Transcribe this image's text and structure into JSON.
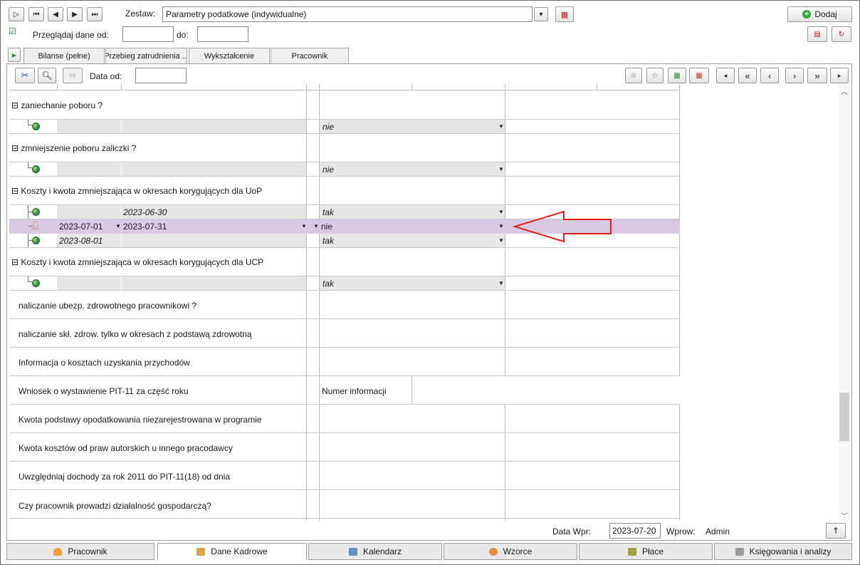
{
  "toolbar": {
    "zestaw_label": "Zestaw:",
    "zestaw_value": "Parametry podatkowe (indywidualne)",
    "dodaj_label": "Dodaj",
    "przegladaj_label": "Przeglądaj dane od:",
    "do_label": "do:",
    "od_value": "",
    "do_value": ""
  },
  "tabs": [
    {
      "label": "Bilanse (pełne)"
    },
    {
      "label": "Przebieg zatrudnienia ..."
    },
    {
      "label": "Wykształcenie"
    },
    {
      "label": "Pracownik"
    }
  ],
  "subtoolbar": {
    "data_od_label": "Data od:",
    "data_od_value": ""
  },
  "nav": {
    "first": "«",
    "prev": "‹",
    "next": "›",
    "last": "»"
  },
  "rows": {
    "g1": "zaniechanie poboru ?",
    "g1v": "nie",
    "g2": "zmniejszenie poboru zaliczki ?",
    "g2v": "nie",
    "g3": "Koszty i kwota zmniejszająca w okresach korygujących dla UoP",
    "g3r1_to": "2023-06-30",
    "g3r1_v": "tak",
    "g3r2_from": "2023-07-01",
    "g3r2_to": "2023-07-31",
    "g3r2_v": "nie",
    "g3r3_from": "2023-08-01",
    "g3r3_v": "tak",
    "g4": "Koszty i kwota zmniejszająca w okresach korygujących dla UCP",
    "g4v": "tak",
    "p1": "naliczanie ubezp. zdrowotnego pracownikowi ?",
    "p2": "naliczanie skł. zdrow. tylko w okresach z podstawą zdrowotną",
    "p3": "Informacja o kosztach uzyskania przychodów",
    "p4": "Wniosek o wystawienie PIT-11 za część roku",
    "p4c": "Numer informacji",
    "p5": "Kwota podstawy opodatkowania niezarejestrowana w programie",
    "p6": "Kwota kosztów od praw autorskich u innego pracodawcy",
    "p7": "Uwzględniaj dochody za rok 2011 do PIT-11(18) od dnia",
    "p8": "Czy pracownik prowadzi działalność gospodarczą?"
  },
  "status": {
    "data_wpr_label": "Data Wpr:",
    "data_wpr_value": "2023-07-20",
    "wprow_label": "Wprow:",
    "wprow_value": "Admin"
  },
  "bottom_tabs": [
    {
      "label": "Pracownik"
    },
    {
      "label": "Dane Kadrowe"
    },
    {
      "label": "Kalendarz"
    },
    {
      "label": "Wzorce"
    },
    {
      "label": "Płace"
    },
    {
      "label": "Księgowania i analizy"
    }
  ],
  "colors": {
    "highlight": "#d9c9e0",
    "arrow": "#e02020"
  }
}
